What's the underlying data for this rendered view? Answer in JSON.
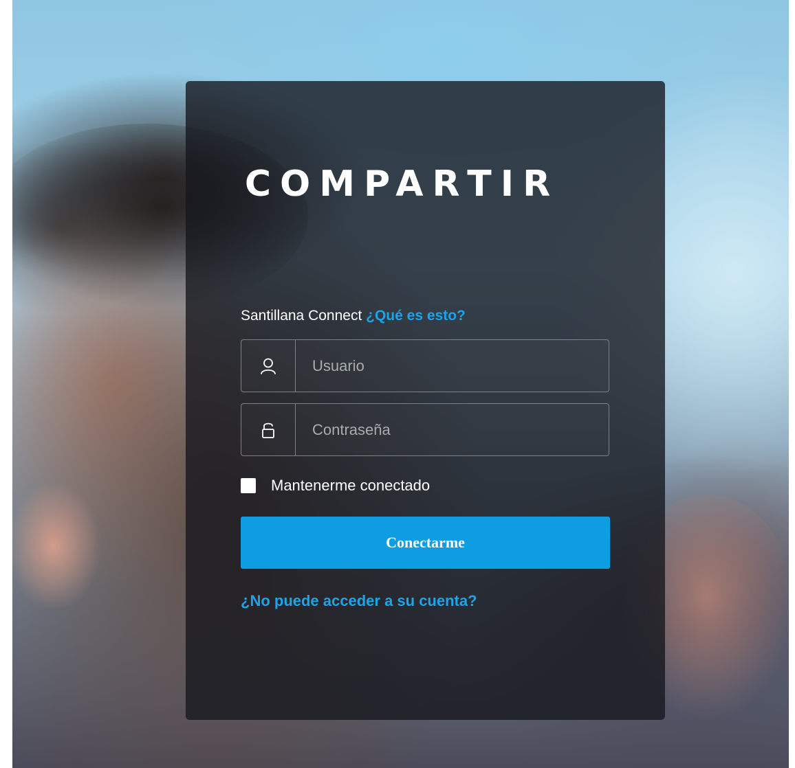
{
  "brand": {
    "logo_text": "COMPARTIR"
  },
  "connect": {
    "label": "Santillana Connect",
    "help_link": "¿Qué es esto?"
  },
  "form": {
    "username_placeholder": "Usuario",
    "password_placeholder": "Contraseña",
    "username_icon": "user-icon",
    "password_icon": "lock-icon",
    "remember_label": "Mantenerme conectado",
    "remember_checked": false,
    "submit_label": "Conectarme",
    "forgot_link": "¿No puede acceder a su cuenta?"
  },
  "colors": {
    "accent": "#0e9ce2",
    "link": "#1ca4e8",
    "panel": "#14161c"
  }
}
